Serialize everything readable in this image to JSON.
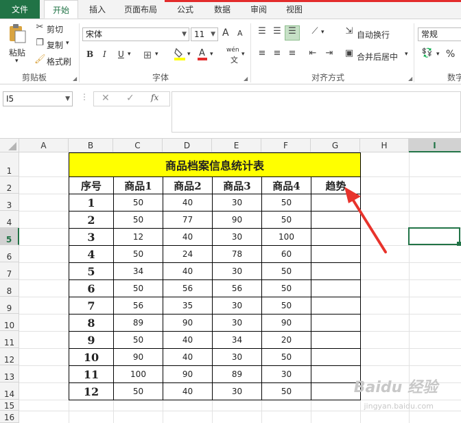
{
  "tabs": [
    "文件",
    "开始",
    "插入",
    "页面布局",
    "公式",
    "数据",
    "审阅",
    "视图"
  ],
  "clipboard": {
    "paste": "粘贴",
    "cut": "剪切",
    "copy": "复制",
    "format_painter": "格式刷",
    "group": "剪贴板"
  },
  "font": {
    "name": "宋体",
    "size": "11",
    "increase": "A",
    "decrease": "A",
    "bold": "B",
    "italic": "I",
    "underline": "U",
    "phonetic": "wén",
    "group": "字体"
  },
  "alignment": {
    "wrap": "自动换行",
    "merge": "合并后居中",
    "group": "对齐方式"
  },
  "number": {
    "format": "常规",
    "percent": "%",
    "group": "数字"
  },
  "formula_bar": {
    "name_box": "I5",
    "cancel": "✕",
    "enter": "✓",
    "fx": "fx",
    "formula": ""
  },
  "columns": [
    "A",
    "B",
    "C",
    "D",
    "E",
    "F",
    "G",
    "H",
    "I"
  ],
  "rows": [
    "1",
    "2",
    "3",
    "4",
    "5",
    "6",
    "7",
    "8",
    "9",
    "10",
    "11",
    "12",
    "13",
    "14",
    "15",
    "16"
  ],
  "sheet": {
    "title": "商品档案信息统计表",
    "headers": [
      "序号",
      "商品1",
      "商品2",
      "商品3",
      "商品4",
      "趋势"
    ],
    "data": [
      [
        "1",
        "50",
        "40",
        "30",
        "50"
      ],
      [
        "2",
        "50",
        "77",
        "90",
        "50"
      ],
      [
        "3",
        "12",
        "40",
        "30",
        "100"
      ],
      [
        "4",
        "50",
        "24",
        "78",
        "60"
      ],
      [
        "5",
        "34",
        "40",
        "30",
        "50"
      ],
      [
        "6",
        "50",
        "56",
        "56",
        "50"
      ],
      [
        "7",
        "56",
        "35",
        "30",
        "50"
      ],
      [
        "8",
        "89",
        "90",
        "30",
        "90"
      ],
      [
        "9",
        "50",
        "40",
        "34",
        "20"
      ],
      [
        "10",
        "90",
        "40",
        "30",
        "50"
      ],
      [
        "11",
        "100",
        "90",
        "89",
        "30"
      ],
      [
        "12",
        "50",
        "40",
        "30",
        "50"
      ]
    ]
  },
  "colors": {
    "accent": "#217346",
    "title_fill": "#ffff00",
    "arrow": "#e8332c",
    "selection": "#217346"
  },
  "watermark": {
    "brand": "Baidu 经验",
    "url": "jingyan.baidu.com"
  }
}
